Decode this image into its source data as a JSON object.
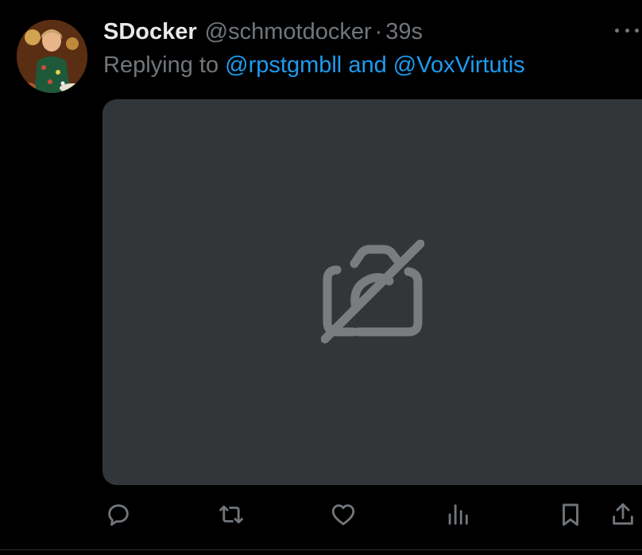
{
  "tweet": {
    "display_name": "SDocker",
    "handle": "@schmotdocker",
    "separator": "·",
    "time": "39s",
    "replying_prefix": "Replying to",
    "reply_mention_1": "@rpstgmbll",
    "reply_conjunction": "and",
    "reply_mention_2": "@VoxVirtutis"
  },
  "media": {
    "state": "image-unavailable",
    "icon": "camera-off-icon"
  },
  "actions": [
    {
      "name": "reply",
      "icon": "reply-icon"
    },
    {
      "name": "retweet",
      "icon": "retweet-icon"
    },
    {
      "name": "like",
      "icon": "heart-icon"
    },
    {
      "name": "views",
      "icon": "views-icon"
    },
    {
      "name": "bookmark",
      "icon": "bookmark-icon"
    },
    {
      "name": "share",
      "icon": "share-icon"
    }
  ],
  "colors": {
    "background": "#000000",
    "text_primary": "#e7e9ea",
    "text_secondary": "#71767b",
    "accent": "#1d9bf0",
    "media_placeholder": "#333639"
  }
}
